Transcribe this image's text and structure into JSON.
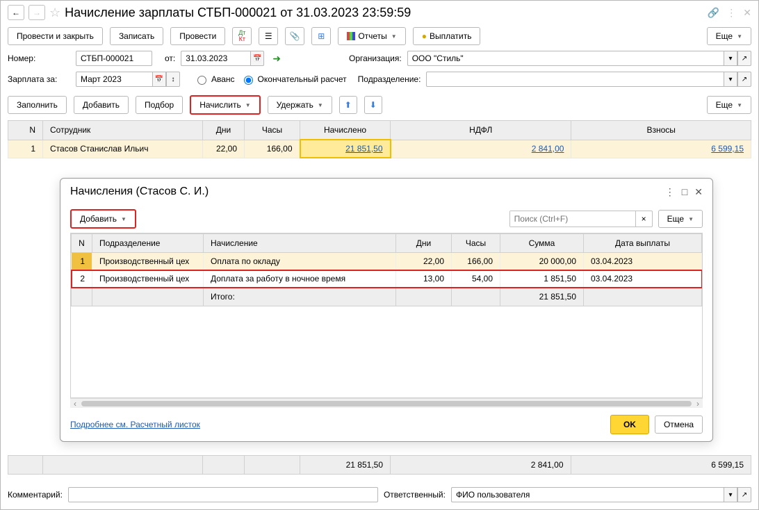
{
  "titlebar": {
    "title": "Начисление зарплаты СТБП-000021 от 31.03.2023 23:59:59"
  },
  "toolbar": {
    "post_and_close": "Провести и закрыть",
    "save": "Записать",
    "post": "Провести",
    "reports": "Отчеты",
    "pay": "Выплатить",
    "more": "Еще"
  },
  "form": {
    "number_label": "Номер:",
    "number_value": "СТБП-000021",
    "from_label": "от:",
    "date_value": "31.03.2023",
    "org_label": "Организация:",
    "org_value": "ООО \"Стиль\"",
    "salary_for_label": "Зарплата за:",
    "salary_for_value": "Март 2023",
    "advance_label": "Аванс",
    "final_label": "Окончательный расчет",
    "dept_label": "Подразделение:",
    "dept_value": ""
  },
  "actions": {
    "fill": "Заполнить",
    "add": "Добавить",
    "pick": "Подбор",
    "accrue": "Начислить",
    "withhold": "Удержать",
    "more": "Еще"
  },
  "main_table": {
    "headers": {
      "n": "N",
      "employee": "Сотрудник",
      "days": "Дни",
      "hours": "Часы",
      "accrued": "Начислено",
      "tax": "НДФЛ",
      "contrib": "Взносы"
    },
    "rows": [
      {
        "n": "1",
        "employee": "Стасов Станислав Ильич",
        "days": "22,00",
        "hours": "166,00",
        "accrued": "21 851,50",
        "tax": "2 841,00",
        "contrib": "6 599,15"
      }
    ],
    "totals": {
      "accrued": "21 851,50",
      "tax": "2 841,00",
      "contrib": "6 599,15"
    }
  },
  "modal": {
    "title": "Начисления (Стасов С. И.)",
    "add": "Добавить",
    "search_placeholder": "Поиск (Ctrl+F)",
    "more": "Еще",
    "headers": {
      "n": "N",
      "dept": "Подразделение",
      "accrual": "Начисление",
      "days": "Дни",
      "hours": "Часы",
      "sum": "Сумма",
      "pay_date": "Дата выплаты"
    },
    "rows": [
      {
        "n": "1",
        "dept": "Производственный цех",
        "accrual": "Оплата по окладу",
        "days": "22,00",
        "hours": "166,00",
        "sum": "20 000,00",
        "pay_date": "03.04.2023"
      },
      {
        "n": "2",
        "dept": "Производственный цех",
        "accrual": "Доплата за работу в ночное время",
        "days": "13,00",
        "hours": "54,00",
        "sum": "1 851,50",
        "pay_date": "03.04.2023"
      }
    ],
    "total_label": "Итого:",
    "total_sum": "21 851,50",
    "detail_link": "Подробнее см. Расчетный листок",
    "ok": "OK",
    "cancel": "Отмена"
  },
  "bottom": {
    "comment_label": "Комментарий:",
    "comment_value": "",
    "resp_label": "Ответственный:",
    "resp_value": "ФИО пользователя"
  }
}
